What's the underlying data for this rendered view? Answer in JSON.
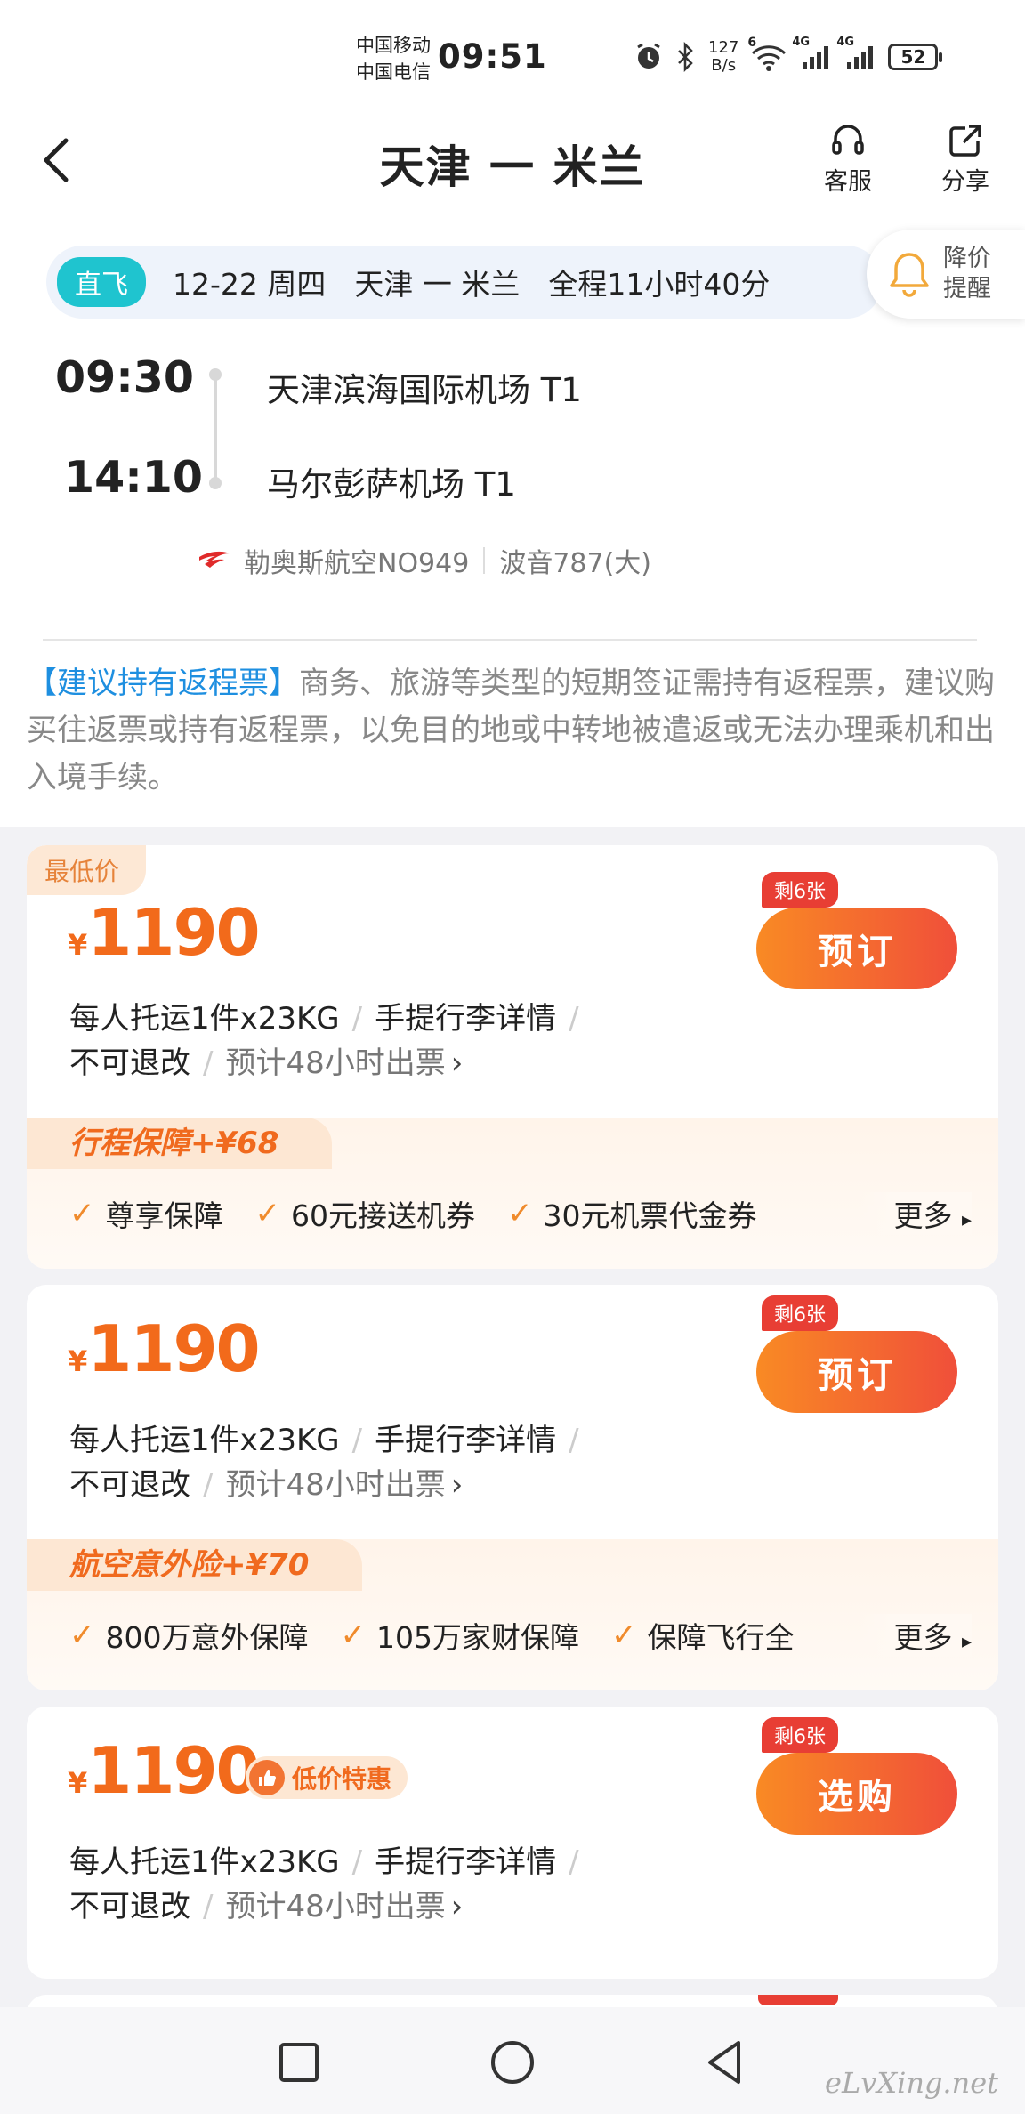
{
  "status_bar": {
    "carrier1": "中国移动",
    "carrier2": "中国电信",
    "time": "09:51",
    "net_speed_value": "127",
    "net_speed_unit": "B/s",
    "battery": "52",
    "signal1": "4G",
    "signal2": "4G",
    "wifi": "6"
  },
  "nav": {
    "title": "天津 一 米兰",
    "service_label": "客服",
    "share_label": "分享"
  },
  "summary": {
    "tag": "直飞",
    "date": "12-22 周四",
    "route": "天津 一 米兰",
    "duration": "全程11小时40分",
    "alert_label_1": "降价",
    "alert_label_2": "提醒"
  },
  "flight": {
    "dep_time": "09:30",
    "dep_airport": "天津滨海国际机场 T1",
    "arr_time": "14:10",
    "arr_airport": "马尔彭萨机场 T1",
    "airline": "勒奥斯航空NO949",
    "aircraft": "波音787(大)"
  },
  "notice": {
    "highlight": "【建议持有返程票】",
    "text": "商务、旅游等类型的短期签证需持有返程票，建议购买往返票或持有返程票，以免目的地或中转地被遣返或无法办理乘机和出入境手续。"
  },
  "offers": [
    {
      "tag": "最低价",
      "currency": "¥",
      "price": "1190",
      "remaining": "剩6张",
      "button": "预订",
      "baggage": "每人托运1件x23KG",
      "carry_on": "手提行李详情",
      "refund": "不可退改",
      "ticketing": "预计48小时出票",
      "insurance_title": "行程保障+¥68",
      "insurance_items": [
        "尊享保障",
        "60元接送机券",
        "30元机票代金券"
      ],
      "more": "更多"
    },
    {
      "currency": "¥",
      "price": "1190",
      "remaining": "剩6张",
      "button": "预订",
      "baggage": "每人托运1件x23KG",
      "carry_on": "手提行李详情",
      "refund": "不可退改",
      "ticketing": "预计48小时出票",
      "insurance_title": "航空意外险+¥70",
      "insurance_items": [
        "800万意外保障",
        "105万家财保障",
        "保障飞行全"
      ],
      "more": "更多"
    },
    {
      "currency": "¥",
      "price": "1190",
      "badge": "低价特惠",
      "remaining": "剩6张",
      "button": "选购",
      "baggage": "每人托运1件x23KG",
      "carry_on": "手提行李详情",
      "refund": "不可退改",
      "ticketing": "预计48小时出票"
    }
  ],
  "watermark": "eLvXing.net",
  "colors": {
    "accent_orange": "#f26a1b",
    "direct_tag": "#1fc4cf",
    "notice_blue": "#1e8fe0",
    "remain_red": "#e83e34"
  }
}
